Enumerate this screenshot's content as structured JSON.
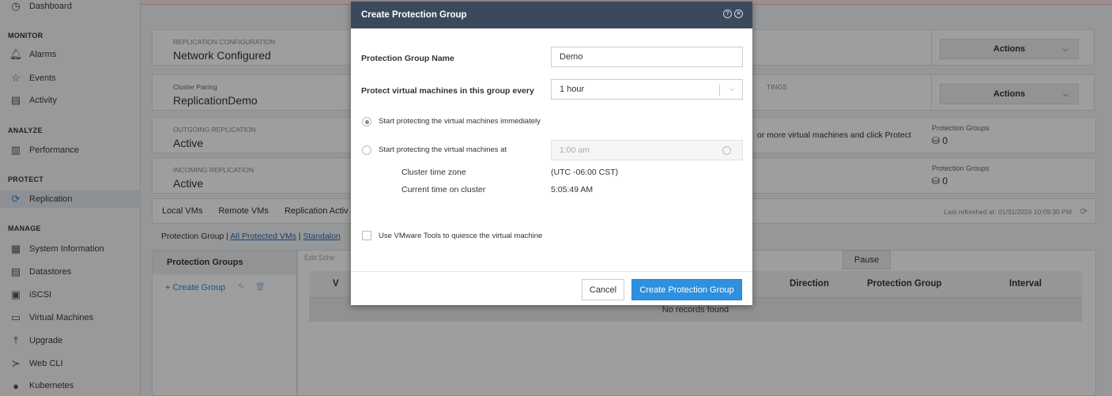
{
  "sidebar": {
    "top_item": "Dashboard",
    "sections": [
      {
        "title": "MONITOR",
        "items": [
          "Alarms",
          "Events",
          "Activity"
        ]
      },
      {
        "title": "ANALYZE",
        "items": [
          "Performance"
        ]
      },
      {
        "title": "PROTECT",
        "items": [
          "Replication"
        ]
      },
      {
        "title": "MANAGE",
        "items": [
          "System Information",
          "Datastores",
          "iSCSI",
          "Virtual Machines",
          "Upgrade",
          "Web CLI",
          "Kubernetes"
        ]
      }
    ]
  },
  "cards": [
    {
      "caption": "REPLICATION CONFIGURATION",
      "value": "Network Configured"
    },
    {
      "caption": "Cluster Pairing",
      "value": "ReplicationDemo"
    },
    {
      "caption": "OUTGOING REPLICATION",
      "value": "Active"
    },
    {
      "caption": "INCOMING REPLICATION",
      "value": "Active"
    }
  ],
  "right": {
    "actions_label": "Actions",
    "settings_fragment": "TINGS",
    "hint_text": "or more virtual machines and click Protect",
    "protection_groups_caption": "Protection Groups",
    "protection_groups_out": "0",
    "protection_groups_in": "0"
  },
  "tabs": [
    "Local VMs",
    "Remote VMs",
    "Replication Activ"
  ],
  "last_refreshed": "Last refreshed at: 01/31/2024 10:09:30 PM",
  "sublinks": {
    "protection_group": "Protection Group",
    "all_protected": "All Protected VMs",
    "standalone": "Standalon"
  },
  "groups_panel": {
    "header": "Protection Groups",
    "create": "+ Create Group",
    "edit_schedule": "Edit Sche"
  },
  "table": {
    "pause": "Pause",
    "columns": [
      "V",
      "Direction",
      "Protection Group",
      "Interval"
    ],
    "empty": "No records found"
  },
  "modal": {
    "title": "Create Protection Group",
    "name_label": "Protection Group Name",
    "name_value": "Demo",
    "every_label": "Protect virtual machines in this group every",
    "every_value": "1 hour",
    "radio_immediately": "Start protecting the virtual machines immediately",
    "radio_at": "Start protecting the virtual machines at",
    "time_value": "1:00 am",
    "tz_label": "Cluster time zone",
    "tz_value": "(UTC -06:00 CST)",
    "current_label": "Current time on cluster",
    "current_value": "5:05:49 AM",
    "quiesce_label": "Use VMware Tools to quiesce the virtual machine",
    "cancel": "Cancel",
    "create": "Create Protection Group"
  },
  "colors": {
    "modal_header": "#3a4a5c",
    "primary_button": "#2e90de",
    "link": "#2e8bd6"
  }
}
